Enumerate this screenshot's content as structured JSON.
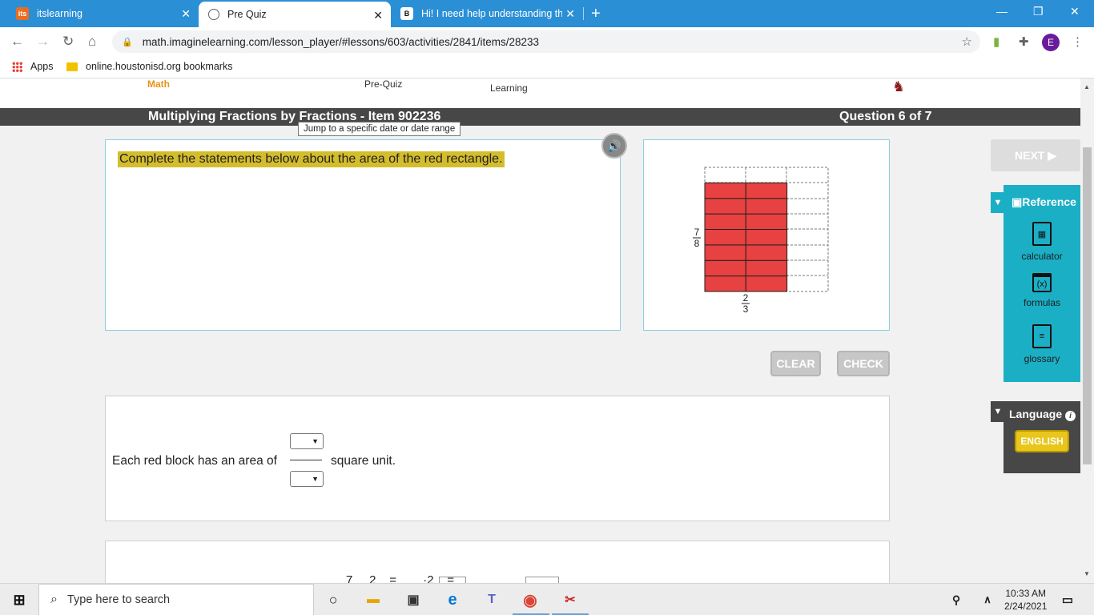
{
  "browser": {
    "tabs": [
      {
        "title": "itslearning",
        "favicon": "its"
      },
      {
        "title": "Pre Quiz",
        "favicon": "globe-icon"
      },
      {
        "title": "Hi! I need help understanding th",
        "favicon": "B"
      }
    ],
    "url": "math.imaginelearning.com/lesson_player/#lessons/603/activities/2841/items/28233",
    "profile_initial": "E",
    "bookmarks": {
      "apps": "Apps",
      "folder": "online.houstonisd.org bookmarks"
    }
  },
  "lesson": {
    "nav_math": "Math",
    "nav_prequiz": "Pre-Quiz",
    "nav_learning": "Learning",
    "title": "Multiplying Fractions by Fractions - Item 902236",
    "question_counter": "Question 6 of 7",
    "tooltip": "Jump to a specific date or date range",
    "prompt": "Complete the statements below about the area of the red rectangle.",
    "figure": {
      "side_label_num": "7",
      "side_label_den": "8",
      "bottom_label_num": "2",
      "bottom_label_den": "3",
      "fill_color": "#e84141"
    },
    "clear_label": "CLEAR",
    "check_label": "CHECK",
    "next_label": "NEXT ▶",
    "statement_prefix": "Each red block has an area of",
    "statement_suffix": "square unit.",
    "next_preview": "7     2    =        ·2    ="
  },
  "reference": {
    "header": "Reference",
    "tools": [
      {
        "label": "calculator",
        "icon": "calculator-icon"
      },
      {
        "label": "formulas",
        "icon": "formulas-icon"
      },
      {
        "label": "glossary",
        "icon": "clipboard-icon"
      }
    ]
  },
  "language": {
    "header": "Language",
    "button": "ENGLISH"
  },
  "taskbar": {
    "search_placeholder": "Type here to search",
    "time": "10:33 AM",
    "date": "2/24/2021"
  }
}
